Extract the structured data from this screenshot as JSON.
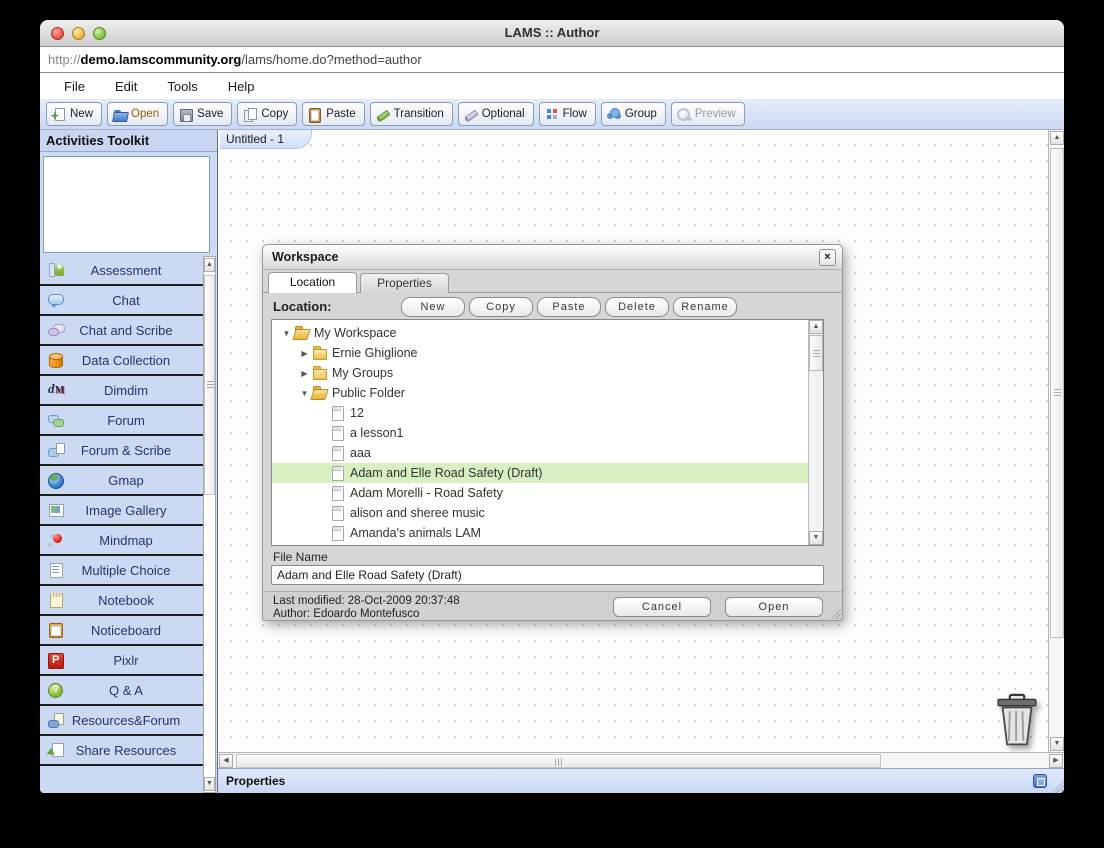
{
  "colors": {
    "toolbar_blue": "#ccd9f3",
    "selection_green": "#d8efc1",
    "dialog_gray": "#d6d6d6",
    "sidebar_text": "#22366b",
    "open_button_highlight": "#995c00"
  },
  "window": {
    "title": "LAMS :: Author"
  },
  "url_bar": {
    "protocol": "http://",
    "domain": "demo.lamscommunity.org",
    "path": "/lams/home.do?method=author"
  },
  "menu": {
    "items": [
      {
        "label": "File",
        "name": "menu-file"
      },
      {
        "label": "Edit",
        "name": "menu-edit"
      },
      {
        "label": "Tools",
        "name": "menu-tools"
      },
      {
        "label": "Help",
        "name": "menu-help"
      }
    ]
  },
  "toolbar": {
    "buttons": [
      {
        "label": "New",
        "name": "new-button",
        "icon": "new-icon"
      },
      {
        "label": "Open",
        "name": "open-button",
        "icon": "open-icon",
        "highlight": true
      },
      {
        "label": "Save",
        "name": "save-button",
        "icon": "save-icon"
      },
      {
        "label": "Copy",
        "name": "copy-button",
        "icon": "copy-icon"
      },
      {
        "label": "Paste",
        "name": "paste-button",
        "icon": "paste-icon"
      },
      {
        "label": "Transition",
        "name": "transition-button",
        "icon": "transition-icon"
      },
      {
        "label": "Optional",
        "name": "optional-button",
        "icon": "optional-icon"
      },
      {
        "label": "Flow",
        "name": "flow-button",
        "icon": "flow-icon"
      },
      {
        "label": "Group",
        "name": "group-button",
        "icon": "group-icon"
      },
      {
        "label": "Preview",
        "name": "preview-button",
        "icon": "preview-icon",
        "disabled": true
      }
    ]
  },
  "sidebar": {
    "title": "Activities Toolkit",
    "items": [
      {
        "label": "Assessment",
        "name": "tool-assessment",
        "icon": "assessment-icon"
      },
      {
        "label": "Chat",
        "name": "tool-chat",
        "icon": "chat-icon"
      },
      {
        "label": "Chat and Scribe",
        "name": "tool-chat-and-scribe",
        "icon": "chat-and-scribe-icon"
      },
      {
        "label": "Data Collection",
        "name": "tool-data-collection",
        "icon": "data-collection-icon"
      },
      {
        "label": "Dimdim",
        "name": "tool-dimdim",
        "icon": "dimdim-icon"
      },
      {
        "label": "Forum",
        "name": "tool-forum",
        "icon": "forum-icon"
      },
      {
        "label": "Forum & Scribe",
        "name": "tool-forum-and-scribe",
        "icon": "forum-and-scribe-icon"
      },
      {
        "label": "Gmap",
        "name": "tool-gmap",
        "icon": "gmap-icon"
      },
      {
        "label": "Image Gallery",
        "name": "tool-image-gallery",
        "icon": "image-gallery-icon"
      },
      {
        "label": "Mindmap",
        "name": "tool-mindmap",
        "icon": "mindmap-icon"
      },
      {
        "label": "Multiple Choice",
        "name": "tool-multiple-choice",
        "icon": "multiple-choice-icon"
      },
      {
        "label": "Notebook",
        "name": "tool-notebook",
        "icon": "notebook-icon"
      },
      {
        "label": "Noticeboard",
        "name": "tool-noticeboard",
        "icon": "noticeboard-icon"
      },
      {
        "label": "Pixlr",
        "name": "tool-pixlr",
        "icon": "pixlr-icon"
      },
      {
        "label": "Q & A",
        "name": "tool-q-and-a",
        "icon": "qa-icon"
      },
      {
        "label": "Resources&Forum",
        "name": "tool-resources-forum",
        "icon": "resources-forum-icon"
      },
      {
        "label": "Share Resources",
        "name": "tool-share-resources",
        "icon": "share-resources-icon"
      }
    ]
  },
  "canvas": {
    "tab_label": "Untitled - 1"
  },
  "dialog": {
    "title": "Workspace",
    "close_label": "×",
    "tabs": [
      {
        "label": "Location",
        "name": "tab-location",
        "active": true
      },
      {
        "label": "Properties",
        "name": "tab-properties"
      }
    ],
    "location_label": "Location:",
    "action_buttons": [
      {
        "label": "New",
        "name": "workspace-new-button"
      },
      {
        "label": "Copy",
        "name": "workspace-copy-button"
      },
      {
        "label": "Paste",
        "name": "workspace-paste-button"
      },
      {
        "label": "Delete",
        "name": "workspace-delete-button"
      },
      {
        "label": "Rename",
        "name": "workspace-rename-button"
      }
    ],
    "tree": [
      {
        "label": "My Workspace",
        "name": "tree-item-my-workspace",
        "indent": 0,
        "disclosure": "open",
        "icon": "folder-open-icon"
      },
      {
        "label": "Ernie Ghiglione",
        "name": "tree-item-ernie-ghiglione",
        "indent": 1,
        "disclosure": "closed",
        "icon": "folder-closed-icon"
      },
      {
        "label": "My Groups",
        "name": "tree-item-my-groups",
        "indent": 1,
        "disclosure": "closed",
        "icon": "folder-closed-icon"
      },
      {
        "label": "Public Folder",
        "name": "tree-item-public-folder",
        "indent": 1,
        "disclosure": "open",
        "icon": "folder-open-icon"
      },
      {
        "label": "12",
        "name": "tree-item-12",
        "indent": 2,
        "icon": "document-icon"
      },
      {
        "label": "a lesson1",
        "name": "tree-item-a-lesson1",
        "indent": 2,
        "icon": "document-icon"
      },
      {
        "label": "aaa",
        "name": "tree-item-aaa",
        "indent": 2,
        "icon": "document-icon"
      },
      {
        "label": "Adam and Elle Road Safety (Draft)",
        "name": "tree-item-adam-and-elle-road-safety",
        "indent": 2,
        "icon": "document-icon",
        "selected": true
      },
      {
        "label": "Adam Morelli - Road Safety",
        "name": "tree-item-adam-morelli-road-safety",
        "indent": 2,
        "icon": "document-icon"
      },
      {
        "label": "alison and sheree music",
        "name": "tree-item-alison-and-sheree-music",
        "indent": 2,
        "icon": "document-icon"
      },
      {
        "label": "Amanda's animals LAM",
        "name": "tree-item-amandas-animals-lam",
        "indent": 2,
        "icon": "document-icon"
      }
    ],
    "file_name_label": "File Name",
    "file_name_value": "Adam and Elle Road Safety (Draft)",
    "last_modified": "Last modified: 28-Oct-2009 20:37:48",
    "author": "Author: Edoardo Montefusco",
    "cancel_label": "Cancel",
    "open_label": "Open"
  },
  "status_bar": {
    "label": "Properties"
  }
}
